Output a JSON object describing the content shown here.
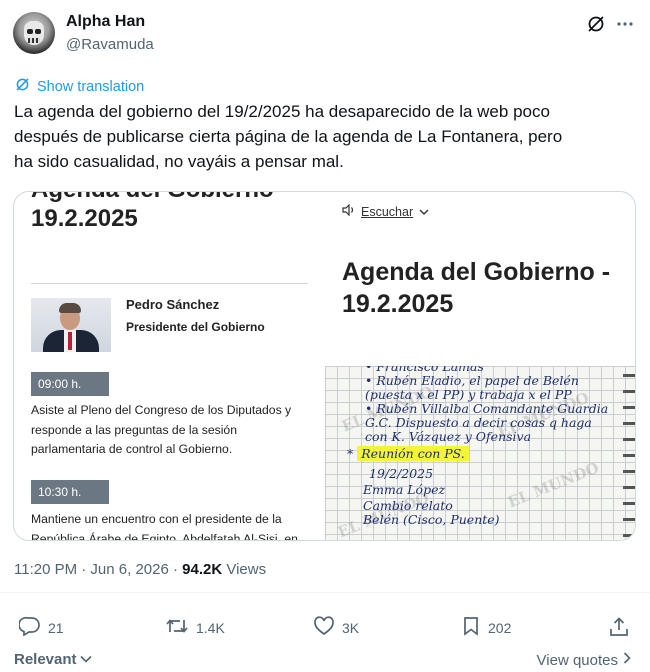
{
  "author": {
    "name": "Alpha Han",
    "handle": "@Ravamuda"
  },
  "translate": {
    "label": "Show translation"
  },
  "tweet": {
    "text_lines": [
      "La agenda del gobierno del 19/2/2025 ha desaparecido de la web poco",
      "después de publicarse cierta página de la agenda de La Fontanera, pero",
      "ha sido casualidad, no vayáis a pensar mal."
    ]
  },
  "media": {
    "title_cut": "Agenda del Gobierno",
    "date_left": "19.2.2025",
    "person": "Pedro Sánchez",
    "role": "Presidente del Gobierno",
    "events": [
      {
        "time": "09:00 h.",
        "lines": [
          "Asiste al Pleno del Congreso de los Diputados y",
          "responde a las preguntas de la sesión",
          "parlamentaria de control al Gobierno."
        ]
      },
      {
        "time": "10:30 h.",
        "lines": [
          "Mantiene un encuentro con el presidente de la",
          "República Árabe de Egipto, Abdelfatah Al-Sisi, en"
        ]
      }
    ],
    "listen_label": "Escuchar",
    "title_right_lines": [
      "Agenda del Gobierno -",
      "19.2.2025"
    ],
    "notebook": {
      "lines": [
        "• Francisco Lamas",
        "• Rubén Eladio, el papel de Belén",
        "  (puesta x el PP) y trabaja x el PP",
        "• Rubén Villalba Comandante Guardia",
        "  G.C. Dispuesto a decir cosas q haga",
        "  con K. Vázquez y Ofensiva",
        "Reunión con PS.",
        "19/2/2025",
        "Emma López",
        "Cambio relato",
        "Belén (Cisco, Puente)"
      ],
      "watermark": "EL MUNDO"
    }
  },
  "meta": {
    "time": "11:20 PM · Jun 6, 2026 · ",
    "views": "94.2K",
    "views_label": " Views"
  },
  "actions": {
    "replies": "21",
    "reposts": "1.4K",
    "likes": "3K",
    "bookmarks": "202"
  },
  "footer": {
    "relevant": "Relevant",
    "view_quotes": "View quotes"
  }
}
